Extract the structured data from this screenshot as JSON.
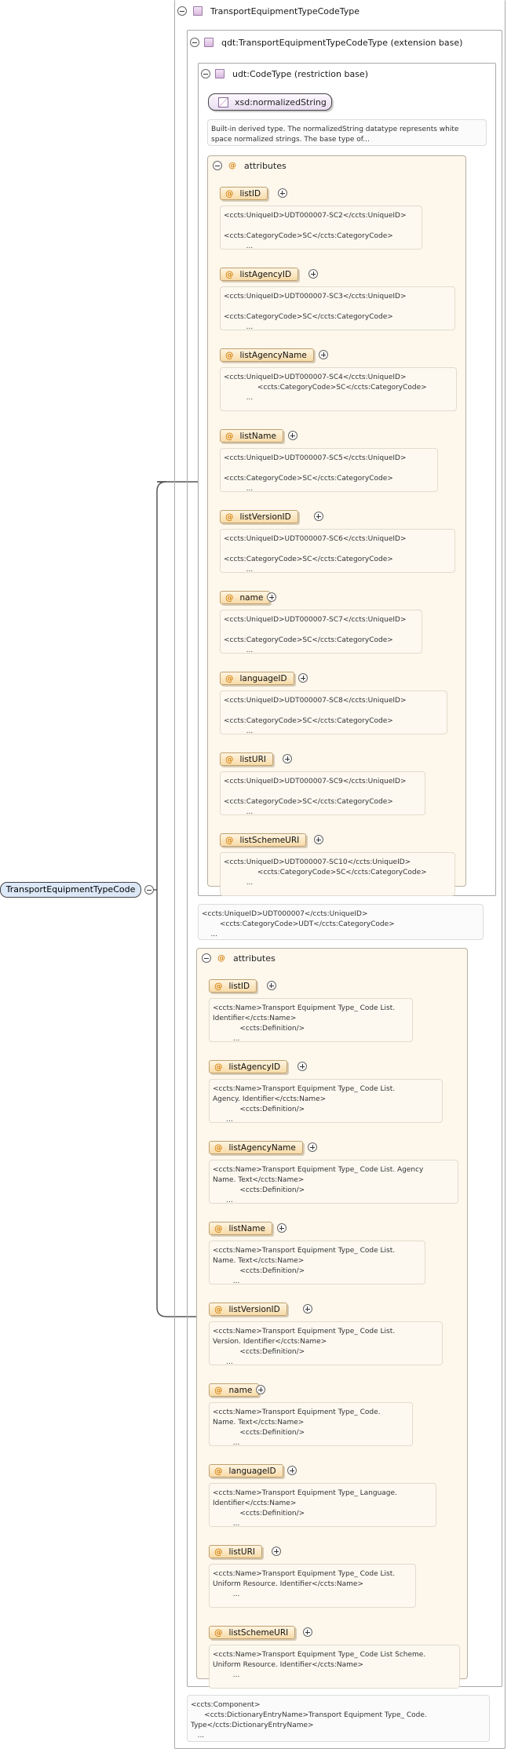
{
  "root_element": "TransportEquipmentTypeCode",
  "complex_type": {
    "label": "TransportEquipmentTypeCodeType"
  },
  "extension": {
    "label": "qdt:TransportEquipmentTypeCodeType (extension base)"
  },
  "restriction": {
    "label": "udt:CodeType (restriction base)"
  },
  "xsd_type": {
    "label": "xsd:normalizedString",
    "doc": "Built-in derived type. The normalizedString datatype represents white\nspace normalized strings. The base type of..."
  },
  "inner_attributes": {
    "label": "attributes",
    "items": [
      {
        "name": "listID",
        "doc": "<ccts:UniqueID>UDT000007-SC2</ccts:UniqueID>\n\n<ccts:CategoryCode>SC</ccts:CategoryCode>\n          ..."
      },
      {
        "name": "listAgencyID",
        "doc": "<ccts:UniqueID>UDT000007-SC3</ccts:UniqueID>\n\n<ccts:CategoryCode>SC</ccts:CategoryCode>\n          ..."
      },
      {
        "name": "listAgencyName",
        "doc": "<ccts:UniqueID>UDT000007-SC4</ccts:UniqueID>\n               <ccts:CategoryCode>SC</ccts:CategoryCode>\n          ..."
      },
      {
        "name": "listName",
        "doc": "<ccts:UniqueID>UDT000007-SC5</ccts:UniqueID>\n\n<ccts:CategoryCode>SC</ccts:CategoryCode>\n          ..."
      },
      {
        "name": "listVersionID",
        "doc": "<ccts:UniqueID>UDT000007-SC6</ccts:UniqueID>\n\n<ccts:CategoryCode>SC</ccts:CategoryCode>\n          ..."
      },
      {
        "name": "name",
        "doc": "<ccts:UniqueID>UDT000007-SC7</ccts:UniqueID>\n\n<ccts:CategoryCode>SC</ccts:CategoryCode>\n          ..."
      },
      {
        "name": "languageID",
        "doc": "<ccts:UniqueID>UDT000007-SC8</ccts:UniqueID>\n\n<ccts:CategoryCode>SC</ccts:CategoryCode>\n          ..."
      },
      {
        "name": "listURI",
        "doc": "<ccts:UniqueID>UDT000007-SC9</ccts:UniqueID>\n\n<ccts:CategoryCode>SC</ccts:CategoryCode>\n          ..."
      },
      {
        "name": "listSchemeURI",
        "doc": "<ccts:UniqueID>UDT000007-SC10</ccts:UniqueID>\n               <ccts:CategoryCode>SC</ccts:CategoryCode>\n          ..."
      }
    ]
  },
  "extension_doc": "<ccts:UniqueID>UDT000007</ccts:UniqueID>\n        <ccts:CategoryCode>UDT</ccts:CategoryCode>\n    ...",
  "outer_attributes": {
    "label": "attributes",
    "items": [
      {
        "name": "listID",
        "doc": "<ccts:Name>Transport Equipment Type_ Code List.\nIdentifier</ccts:Name>\n            <ccts:Definition/>\n         ..."
      },
      {
        "name": "listAgencyID",
        "doc": "<ccts:Name>Transport Equipment Type_ Code List.\nAgency. Identifier</ccts:Name>\n            <ccts:Definition/>\n      ..."
      },
      {
        "name": "listAgencyName",
        "doc": "<ccts:Name>Transport Equipment Type_ Code List. Agency\nName. Text</ccts:Name>\n            <ccts:Definition/>\n      ..."
      },
      {
        "name": "listName",
        "doc": "<ccts:Name>Transport Equipment Type_ Code List.\nName. Text</ccts:Name>\n            <ccts:Definition/>\n         ..."
      },
      {
        "name": "listVersionID",
        "doc": "<ccts:Name>Transport Equipment Type_ Code List.\nVersion. Identifier</ccts:Name>\n            <ccts:Definition/>\n      ..."
      },
      {
        "name": "name",
        "doc": "<ccts:Name>Transport Equipment Type_ Code.\nName. Text</ccts:Name>\n            <ccts:Definition/>\n         ..."
      },
      {
        "name": "languageID",
        "doc": "<ccts:Name>Transport Equipment Type_ Language.\nIdentifier</ccts:Name>\n            <ccts:Definition/>\n         ..."
      },
      {
        "name": "listURI",
        "doc": "<ccts:Name>Transport Equipment Type_ Code List.\nUniform Resource. Identifier</ccts:Name>\n         ..."
      },
      {
        "name": "listSchemeURI",
        "doc": "<ccts:Name>Transport Equipment Type_ Code List Scheme.\nUniform Resource. Identifier</ccts:Name>\n         ..."
      }
    ]
  },
  "component_doc": "<ccts:Component>\n      <ccts:DictionaryEntryName>Transport Equipment Type_ Code.\nType</ccts:DictionaryEntryName>\n   ..."
}
